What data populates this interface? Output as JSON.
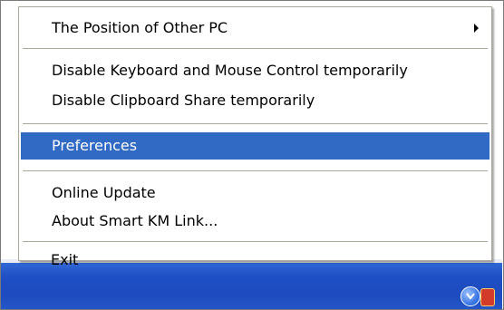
{
  "menu": {
    "items": [
      {
        "label": "The Position of Other PC",
        "has_submenu": true
      },
      {
        "label": "Disable Keyboard and Mouse Control temporarily"
      },
      {
        "label": "Disable Clipboard Share temporarily"
      },
      {
        "label": "Preferences",
        "highlighted": true
      },
      {
        "label": "Online Update"
      },
      {
        "label": "About Smart KM Link..."
      },
      {
        "label": "Exit"
      }
    ]
  },
  "colors": {
    "highlight": "#316ac5",
    "separator": "#aca899",
    "taskbar": "#2457c8"
  },
  "icons": {
    "submenu": "triangle-right-icon",
    "tray_show_hidden": "tray-chevron-icon",
    "tray_app": "tray-app-icon"
  }
}
